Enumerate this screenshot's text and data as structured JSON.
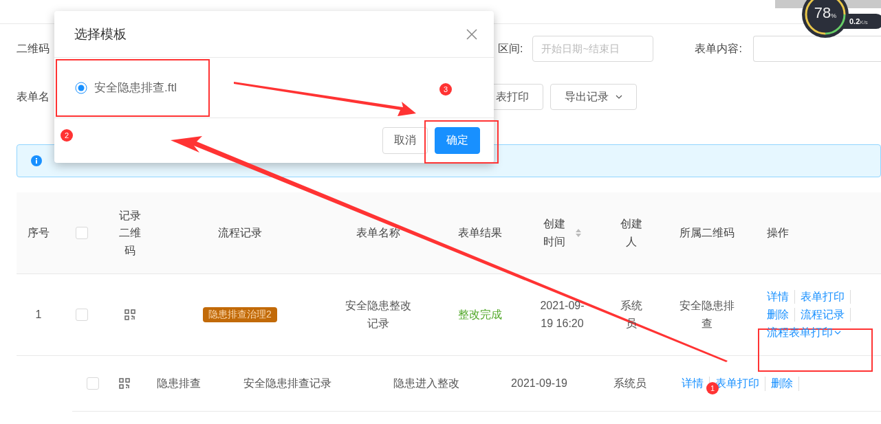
{
  "speed_widget": {
    "percent": "78",
    "percent_unit": "%",
    "speed": "0.2",
    "speed_unit": "K/s"
  },
  "filters": {
    "qr_label": "二维码",
    "date_label": "区间:",
    "date_placeholder": "开始日期~结束日",
    "content_label": "表单内容:",
    "form_name_label": "表单名"
  },
  "toolbar_buttons": [
    {
      "label": "表打印",
      "kind": "plain"
    },
    {
      "label": "导出记录",
      "kind": "dropdown"
    }
  ],
  "alert": {
    "kind": "info"
  },
  "table": {
    "columns": [
      {
        "label": "序号",
        "kind": "text"
      },
      {
        "kind": "checkbox",
        "checked": false
      },
      {
        "label": "记录二维码",
        "kind": "text"
      },
      {
        "label": "流程记录",
        "kind": "text"
      },
      {
        "label": "表单名称",
        "kind": "text"
      },
      {
        "label": "表单结果",
        "kind": "text"
      },
      {
        "label": "创建时间",
        "kind": "sortable"
      },
      {
        "label": "创建人",
        "kind": "text"
      },
      {
        "label": "所属二维码",
        "kind": "text"
      },
      {
        "label": "操作",
        "kind": "text"
      }
    ],
    "rows": [
      {
        "index": "1",
        "checked": false,
        "flow": "隐患排查治理2",
        "form_name": "安全隐患整改记录",
        "result": "整改完成",
        "created": "2021-09-19 16:20",
        "creator": "系统员",
        "qr_name": "安全隐患排查",
        "actions": [
          {
            "label": "详情",
            "kind": "link"
          },
          {
            "label": "表单打印",
            "kind": "link"
          },
          {
            "label": "删除",
            "kind": "link"
          },
          {
            "label": "流程记录",
            "kind": "link"
          },
          {
            "label": "流程表单打印",
            "kind": "dropdown"
          }
        ],
        "children": [
          {
            "checked": false,
            "name": "隐患排查",
            "form_name": "安全隐患排查记录",
            "result": "隐患进入整改",
            "created": "2021-09-19",
            "creator": "系统员",
            "actions": [
              {
                "label": "详情",
                "kind": "link"
              },
              {
                "label": "表单打印",
                "kind": "link"
              },
              {
                "label": "删除",
                "kind": "link"
              }
            ]
          }
        ]
      }
    ]
  },
  "modal": {
    "title": "选择模板",
    "options": [
      {
        "label": "安全隐患排查.ftl",
        "selected": true
      }
    ],
    "buttons": [
      {
        "label": "取消",
        "kind": "default"
      },
      {
        "label": "确定",
        "kind": "primary"
      }
    ]
  },
  "annotations": {
    "badges": [
      "1",
      "2",
      "3"
    ]
  }
}
